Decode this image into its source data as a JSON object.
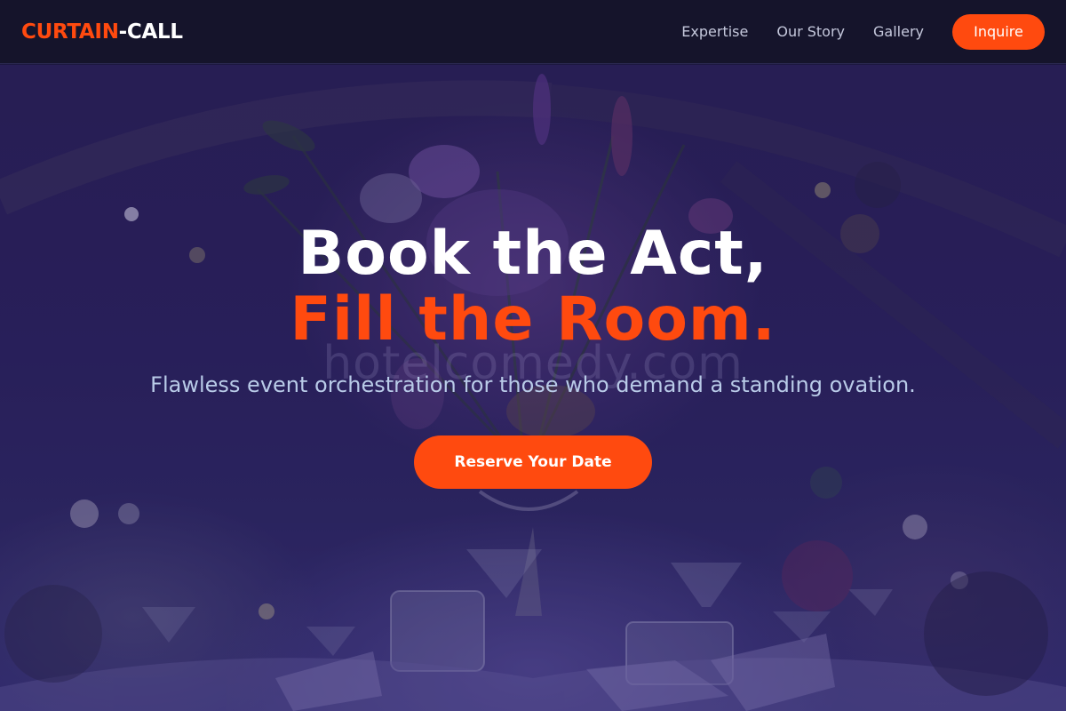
{
  "brand": {
    "logo_part1": "CURTAIN",
    "logo_part2": "-CALL"
  },
  "nav": {
    "items": [
      {
        "label": "Expertise"
      },
      {
        "label": "Our Story"
      },
      {
        "label": "Gallery"
      }
    ],
    "cta_label": "Inquire"
  },
  "hero": {
    "headline_line1": "Book the Act,",
    "headline_line2": "Fill the Room.",
    "watermark": "hotelcomedy.com",
    "tagline": "Flawless event orchestration for those who demand a standing ovation.",
    "cta_label": "Reserve Your Date"
  },
  "colors": {
    "accent": "#ff4a0f",
    "header_bg": "#15142b",
    "hero_bg": "#2a2058",
    "tagline": "#b9cbe8"
  }
}
